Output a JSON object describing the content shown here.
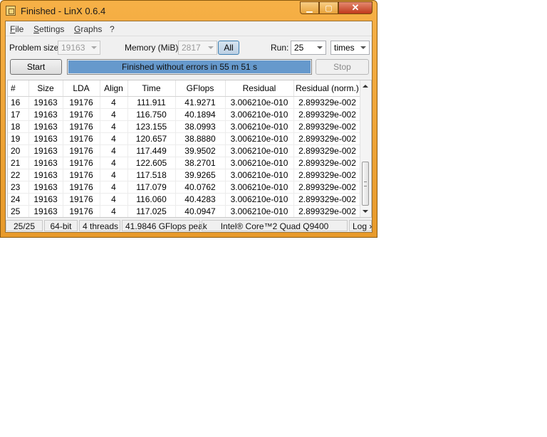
{
  "window": {
    "title": "Finished - LinX 0.6.4",
    "min_glyph": "▁",
    "max_glyph": "▢",
    "close_glyph": "✕"
  },
  "menu": {
    "file": {
      "accel": "F",
      "rest": "ile"
    },
    "settings": {
      "accel": "S",
      "rest": "ettings"
    },
    "graphs": {
      "accel": "G",
      "rest": "raphs"
    },
    "help": "?"
  },
  "controls": {
    "problem_size_label": "Problem size:",
    "problem_size_value": "19163",
    "memory_label": "Memory (MiB):",
    "memory_value": "2817",
    "all_button": "All",
    "run_label": "Run:",
    "run_value": "25",
    "times_value": "times",
    "start_button": "Start",
    "stop_button": "Stop"
  },
  "progress": {
    "text": "Finished without errors in 55 m 51 s",
    "percent": 100,
    "color": "#6699cc"
  },
  "table": {
    "headers": [
      "#",
      "Size",
      "LDA",
      "Align",
      "Time",
      "GFlops",
      "Residual",
      "Residual (norm.)"
    ],
    "rows": [
      [
        "16",
        "19163",
        "19176",
        "4",
        "111.911",
        "41.9271",
        "3.006210e-010",
        "2.899329e-002"
      ],
      [
        "17",
        "19163",
        "19176",
        "4",
        "116.750",
        "40.1894",
        "3.006210e-010",
        "2.899329e-002"
      ],
      [
        "18",
        "19163",
        "19176",
        "4",
        "123.155",
        "38.0993",
        "3.006210e-010",
        "2.899329e-002"
      ],
      [
        "19",
        "19163",
        "19176",
        "4",
        "120.657",
        "38.8880",
        "3.006210e-010",
        "2.899329e-002"
      ],
      [
        "20",
        "19163",
        "19176",
        "4",
        "117.449",
        "39.9502",
        "3.006210e-010",
        "2.899329e-002"
      ],
      [
        "21",
        "19163",
        "19176",
        "4",
        "122.605",
        "38.2701",
        "3.006210e-010",
        "2.899329e-002"
      ],
      [
        "22",
        "19163",
        "19176",
        "4",
        "117.518",
        "39.9265",
        "3.006210e-010",
        "2.899329e-002"
      ],
      [
        "23",
        "19163",
        "19176",
        "4",
        "117.079",
        "40.0762",
        "3.006210e-010",
        "2.899329e-002"
      ],
      [
        "24",
        "19163",
        "19176",
        "4",
        "116.060",
        "40.4283",
        "3.006210e-010",
        "2.899329e-002"
      ],
      [
        "25",
        "19163",
        "19176",
        "4",
        "117.025",
        "40.0947",
        "3.006210e-010",
        "2.899329e-002"
      ]
    ]
  },
  "status": {
    "runs": "25/25",
    "bits": "64-bit",
    "threads": "4 threads",
    "peak": "41.9846 GFlops peak",
    "cpu": "Intel® Core™2 Quad Q9400",
    "log": "Log ›"
  }
}
